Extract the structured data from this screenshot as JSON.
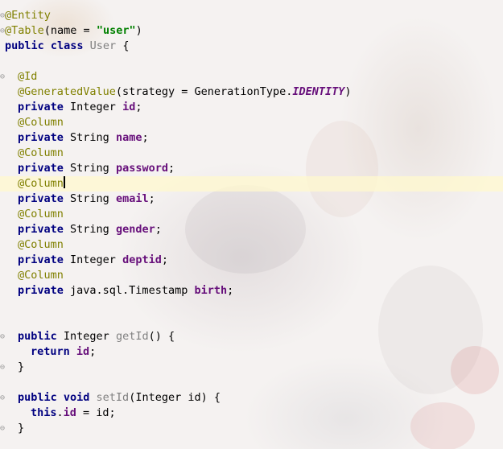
{
  "editor": {
    "lines": [
      {
        "tokens": [
          {
            "t": "@Entity",
            "c": "ann"
          }
        ],
        "indent": 6,
        "gutter": "⊖"
      },
      {
        "tokens": [
          {
            "t": "@Table",
            "c": "ann"
          },
          {
            "t": "(name = ",
            "c": "plain"
          },
          {
            "t": "\"user\"",
            "c": "str"
          },
          {
            "t": ")",
            "c": "plain"
          }
        ],
        "indent": 6,
        "gutter": "⊖"
      },
      {
        "tokens": [
          {
            "t": "public class ",
            "c": "kw"
          },
          {
            "t": "User",
            "c": "unused"
          },
          {
            "t": " {",
            "c": "plain"
          }
        ],
        "indent": 6
      },
      {
        "tokens": [],
        "indent": 6
      },
      {
        "tokens": [
          {
            "t": "@Id",
            "c": "ann"
          }
        ],
        "indent": 22,
        "gutter": "⊖"
      },
      {
        "tokens": [
          {
            "t": "@GeneratedValue",
            "c": "ann"
          },
          {
            "t": "(strategy = GenerationType.",
            "c": "plain"
          },
          {
            "t": "IDENTITY",
            "c": "static"
          },
          {
            "t": ")",
            "c": "plain"
          }
        ],
        "indent": 22
      },
      {
        "tokens": [
          {
            "t": "private ",
            "c": "kw"
          },
          {
            "t": "Integer ",
            "c": "plain"
          },
          {
            "t": "id",
            "c": "field"
          },
          {
            "t": ";",
            "c": "plain"
          }
        ],
        "indent": 22
      },
      {
        "tokens": [
          {
            "t": "@Column",
            "c": "ann"
          }
        ],
        "indent": 22
      },
      {
        "tokens": [
          {
            "t": "private ",
            "c": "kw"
          },
          {
            "t": "String ",
            "c": "plain"
          },
          {
            "t": "name",
            "c": "field"
          },
          {
            "t": ";",
            "c": "plain"
          }
        ],
        "indent": 22
      },
      {
        "tokens": [
          {
            "t": "@Column",
            "c": "ann"
          }
        ],
        "indent": 22
      },
      {
        "tokens": [
          {
            "t": "private ",
            "c": "kw"
          },
          {
            "t": "String ",
            "c": "plain"
          },
          {
            "t": "password",
            "c": "field"
          },
          {
            "t": ";",
            "c": "plain"
          }
        ],
        "indent": 22
      },
      {
        "tokens": [
          {
            "t": "@Column",
            "c": "ann"
          }
        ],
        "indent": 22,
        "caret": true
      },
      {
        "tokens": [
          {
            "t": "private ",
            "c": "kw"
          },
          {
            "t": "String ",
            "c": "plain"
          },
          {
            "t": "email",
            "c": "field"
          },
          {
            "t": ";",
            "c": "plain"
          }
        ],
        "indent": 22
      },
      {
        "tokens": [
          {
            "t": "@Column",
            "c": "ann"
          }
        ],
        "indent": 22
      },
      {
        "tokens": [
          {
            "t": "private ",
            "c": "kw"
          },
          {
            "t": "String ",
            "c": "plain"
          },
          {
            "t": "gender",
            "c": "field"
          },
          {
            "t": ";",
            "c": "plain"
          }
        ],
        "indent": 22
      },
      {
        "tokens": [
          {
            "t": "@Column",
            "c": "ann"
          }
        ],
        "indent": 22
      },
      {
        "tokens": [
          {
            "t": "private ",
            "c": "kw"
          },
          {
            "t": "Integer ",
            "c": "plain"
          },
          {
            "t": "deptid",
            "c": "field"
          },
          {
            "t": ";",
            "c": "plain"
          }
        ],
        "indent": 22
      },
      {
        "tokens": [
          {
            "t": "@Column",
            "c": "ann"
          }
        ],
        "indent": 22
      },
      {
        "tokens": [
          {
            "t": "private ",
            "c": "kw"
          },
          {
            "t": "java.sql.Timestamp ",
            "c": "plain"
          },
          {
            "t": "birth",
            "c": "field"
          },
          {
            "t": ";",
            "c": "plain"
          }
        ],
        "indent": 22
      },
      {
        "tokens": [],
        "indent": 22
      },
      {
        "tokens": [],
        "indent": 22
      },
      {
        "tokens": [
          {
            "t": "public ",
            "c": "kw"
          },
          {
            "t": "Integer ",
            "c": "plain"
          },
          {
            "t": "getId",
            "c": "unused"
          },
          {
            "t": "() {",
            "c": "plain"
          }
        ],
        "indent": 22,
        "gutter": "⊖"
      },
      {
        "tokens": [
          {
            "t": "return ",
            "c": "kw"
          },
          {
            "t": "id",
            "c": "field"
          },
          {
            "t": ";",
            "c": "plain"
          }
        ],
        "indent": 38
      },
      {
        "tokens": [
          {
            "t": "}",
            "c": "plain"
          }
        ],
        "indent": 22,
        "gutter": "⊖"
      },
      {
        "tokens": [],
        "indent": 22
      },
      {
        "tokens": [
          {
            "t": "public void ",
            "c": "kw"
          },
          {
            "t": "setId",
            "c": "unused"
          },
          {
            "t": "(Integer id) {",
            "c": "plain"
          }
        ],
        "indent": 22,
        "gutter": "⊖"
      },
      {
        "tokens": [
          {
            "t": "this",
            "c": "kw"
          },
          {
            "t": ".",
            "c": "plain"
          },
          {
            "t": "id",
            "c": "field"
          },
          {
            "t": " = id;",
            "c": "plain"
          }
        ],
        "indent": 38
      },
      {
        "tokens": [
          {
            "t": "}",
            "c": "plain"
          }
        ],
        "indent": 22,
        "gutter": "⊖"
      }
    ]
  },
  "colors": {
    "keyword": "#000080",
    "annotation": "#808000",
    "string": "#008000",
    "field": "#660e7a",
    "unused": "#808080",
    "caret_line": "#fff8cd"
  }
}
